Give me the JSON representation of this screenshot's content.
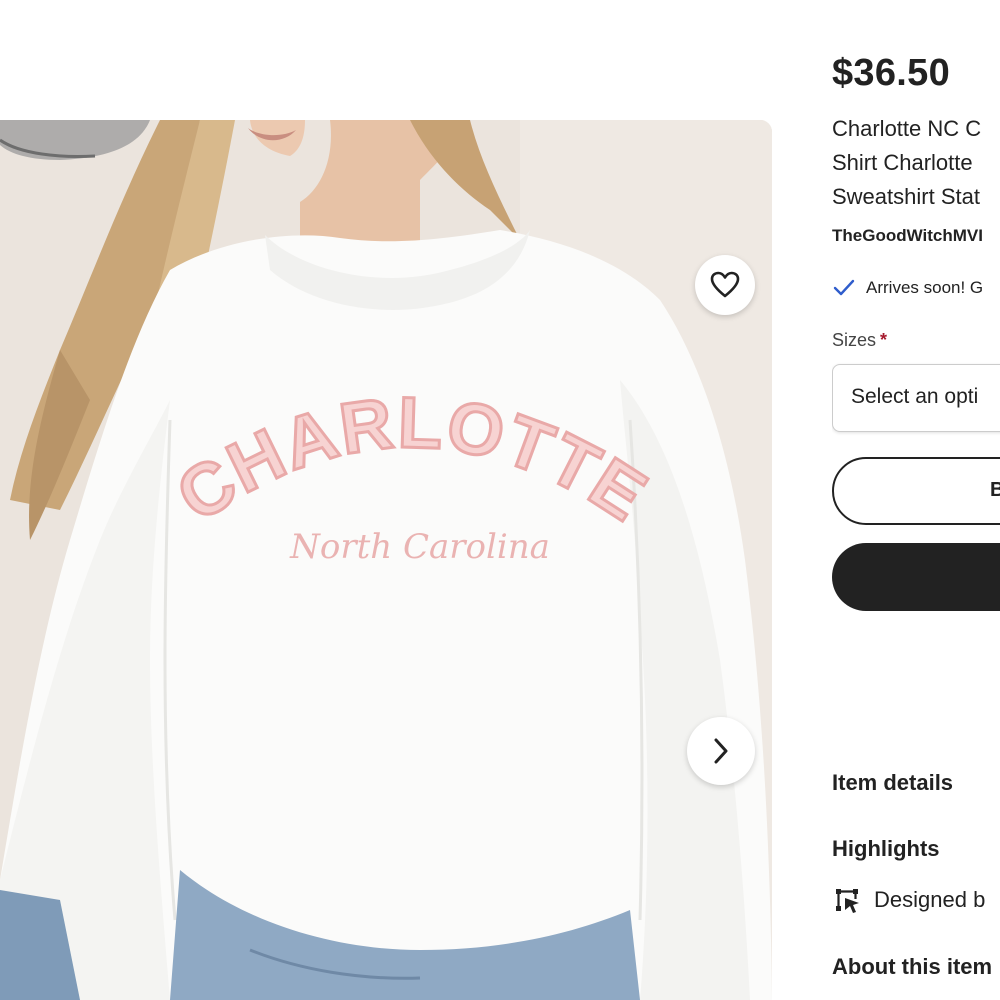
{
  "product": {
    "price": "$36.50",
    "title_lines": [
      "Charlotte NC C",
      "Shirt Charlotte",
      "Sweatshirt Stat"
    ],
    "shop_name": "TheGoodWitchMVI",
    "arrives_text": "Arrives soon! G",
    "sizes_label": "Sizes",
    "required_mark": "*",
    "select_placeholder": "Select an opti",
    "outline_button_label": "B"
  },
  "photo": {
    "print_main": "CHARLOTTE",
    "print_sub": "North Carolina",
    "favorite_icon": "heart-icon",
    "next_icon": "chevron-right-icon"
  },
  "sections": {
    "item_details": "Item details",
    "highlights": "Highlights",
    "designed_by": "Designed b",
    "about": "About this item"
  },
  "colors": {
    "text": "#222222",
    "check": "#2f5dcc",
    "required": "#a61a2e",
    "print_pink": "#f0b9b8"
  }
}
